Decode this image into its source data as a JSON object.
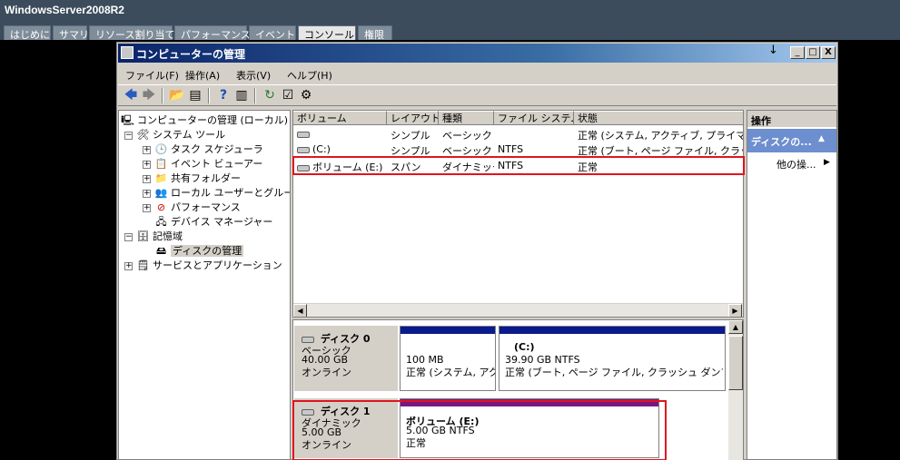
{
  "host": {
    "title": "WindowsServer2008R2",
    "tabs": [
      "はじめに",
      "サマリ",
      "リソース割り当て",
      "パフォーマンス",
      "イベント",
      "コンソール",
      "権限"
    ],
    "active_tab": "コンソール"
  },
  "window": {
    "title": "コンピューターの管理",
    "minimize": "_",
    "maximize": "□",
    "close": "X"
  },
  "menu": {
    "file": "ファイル(F)",
    "action": "操作(A)",
    "view": "表示(V)",
    "help": "ヘルプ(H)"
  },
  "tree": {
    "root": "コンピューターの管理 (ローカル)",
    "system_tools": "システム ツール",
    "task_scheduler": "タスク スケジューラ",
    "event_viewer": "イベント ビューアー",
    "shared_folders": "共有フォルダー",
    "local_users": "ローカル ユーザーとグループ",
    "performance": "パフォーマンス",
    "device_manager": "デバイス マネージャー",
    "storage": "記憶域",
    "disk_management": "ディスクの管理",
    "services_apps": "サービスとアプリケーション"
  },
  "volume_list": {
    "columns": [
      "ボリューム",
      "レイアウト",
      "種類",
      "ファイル システム",
      "状態"
    ],
    "rows": [
      [
        "",
        "シンプル",
        "ベーシック",
        "",
        "正常 (システム, アクティブ, プライマリ パーティション)"
      ],
      [
        "(C:)",
        "シンプル",
        "ベーシック",
        "NTFS",
        "正常 (ブート, ページ ファイル, クラッシュ ダンプ, プライマリ パーティション)"
      ],
      [
        "ボリューム (E:)",
        "スパン",
        "ダイナミック",
        "NTFS",
        "正常"
      ]
    ]
  },
  "disks": [
    {
      "name": "ディスク 0",
      "type": "ベーシック",
      "size": "40.00 GB",
      "status": "オンライン",
      "partitions": [
        {
          "title": "",
          "size": "100 MB",
          "status": "正常 (システム, アクティブ, プライマリ パーティション)"
        },
        {
          "title": "(C:)",
          "size": "39.90 GB NTFS",
          "status": "正常 (ブート, ページ ファイル, クラッシュ ダンプ, プライマリ パーティション)"
        }
      ]
    },
    {
      "name": "ディスク 1",
      "type": "ダイナミック",
      "size": "5.00 GB",
      "status": "オンライン",
      "partitions": [
        {
          "title": "ボリューム (E:)",
          "size": "5.00 GB NTFS",
          "status": "正常"
        }
      ]
    }
  ],
  "actions": {
    "header": "操作",
    "section": "ディスクの...",
    "more": "他の操..."
  },
  "colors": {
    "basic_partition": "#0b1a8c",
    "spanned_volume": "#7a1585",
    "highlight": "#e0141e"
  }
}
